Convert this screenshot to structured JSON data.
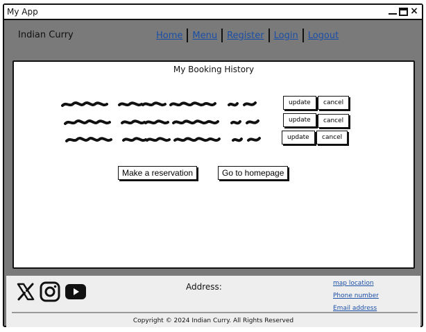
{
  "window": {
    "title": "My App"
  },
  "header": {
    "brand": "Indian Curry",
    "nav": [
      "Home",
      "Menu",
      "Register",
      "Login",
      "Logout"
    ]
  },
  "main": {
    "title": "My Booking History",
    "bookings": [
      {
        "update_label": "update",
        "cancel_label": "cancel"
      },
      {
        "update_label": "update",
        "cancel_label": "cancel"
      },
      {
        "update_label": "update",
        "cancel_label": "cancel"
      }
    ],
    "make_reservation_label": "Make a reservation",
    "homepage_label": "Go to homepage"
  },
  "footer": {
    "icons": [
      "x-icon",
      "instagram-icon",
      "youtube-icon"
    ],
    "address_label": "Address:",
    "links": [
      "map location",
      "Phone number",
      "Email address"
    ],
    "copyright": "Copyright © 2024 Indian Curry. All Rights Reserved"
  }
}
